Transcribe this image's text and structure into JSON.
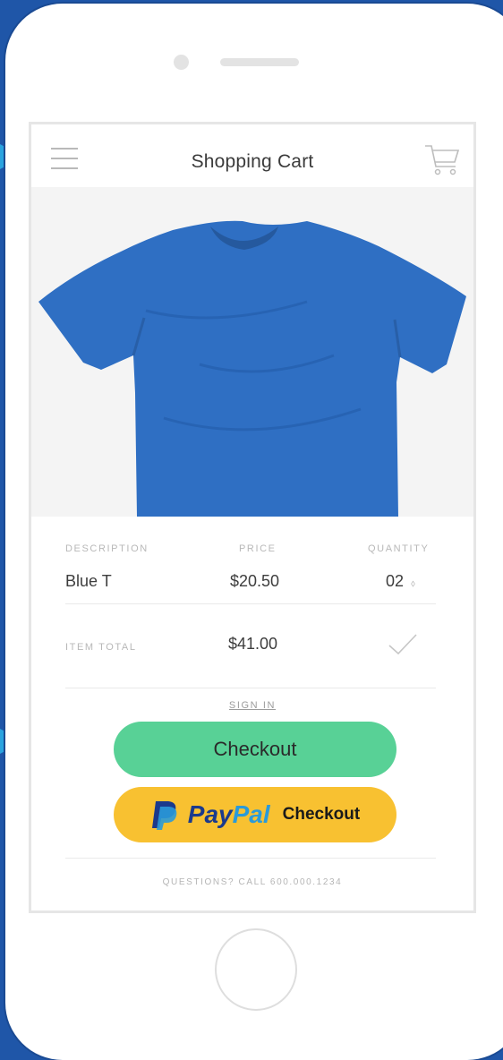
{
  "header": {
    "title": "Shopping Cart",
    "menu_icon": "hamburger-menu-icon",
    "cart_icon": "shopping-cart-icon"
  },
  "product": {
    "image": "blue-tshirt-image",
    "color": "#2f6fc3"
  },
  "table": {
    "headers": [
      "DESCRIPTION",
      "PRICE",
      "QUANTITY"
    ],
    "row": {
      "description": "Blue T",
      "price": "$20.50",
      "quantity": "02",
      "quantity_icon": "stepper-arrows-icon"
    }
  },
  "total": {
    "label": "ITEM TOTAL",
    "value": "$41.00",
    "icon": "checkmark-icon"
  },
  "actions": {
    "sign_in": "SIGN IN",
    "checkout": "Checkout",
    "paypal_pay": "Pay",
    "paypal_pal": "Pal",
    "paypal_checkout": "Checkout"
  },
  "footer": {
    "support": "QUESTIONS? CALL 600.000.1234"
  },
  "colors": {
    "checkout_green": "#58d196",
    "paypal_yellow": "#f8c131",
    "paypal_dark_blue": "#1b3a8c",
    "paypal_light_blue": "#2a9ad9",
    "arrow_blue": "#2aa3df",
    "background_blue": "#1f56a8"
  }
}
